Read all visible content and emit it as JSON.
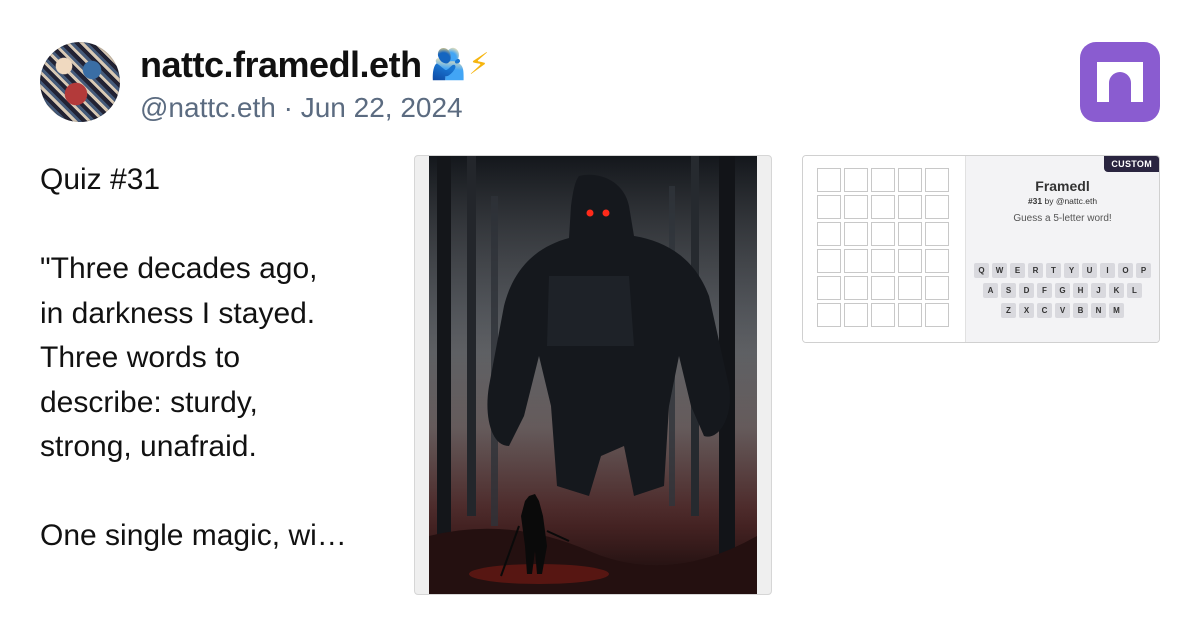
{
  "profile": {
    "display_name": "nattc.framedl.eth",
    "badges": [
      "🫂",
      "⚡"
    ],
    "handle_line": "@nattc.eth · Jun 22, 2024"
  },
  "post": {
    "text": "Quiz #31\n\n\"Three decades ago,\nin darkness I stayed.\nThree words to\ndescribe: sturdy,\nstrong, unafraid.\n\nOne single magic, wi…"
  },
  "frame": {
    "badge": "CUSTOM",
    "title": "Framedl",
    "subtitle_number": "#31",
    "subtitle_rest": " by @nattc.eth",
    "prompt": "Guess a 5-letter word!",
    "keyboard_rows": [
      [
        "Q",
        "W",
        "E",
        "R",
        "T",
        "Y",
        "U",
        "I",
        "O",
        "P"
      ],
      [
        "A",
        "S",
        "D",
        "F",
        "G",
        "H",
        "J",
        "K",
        "L"
      ],
      [
        "Z",
        "X",
        "C",
        "V",
        "B",
        "N",
        "M"
      ]
    ]
  },
  "colors": {
    "app_logo": "#8a5cd0",
    "handle_text": "#5b6b80",
    "custom_badge": "#2a2540"
  },
  "icons": {
    "app_logo": "arch-icon",
    "badge_people": "people-hugging-icon",
    "badge_bolt": "lightning-icon"
  }
}
